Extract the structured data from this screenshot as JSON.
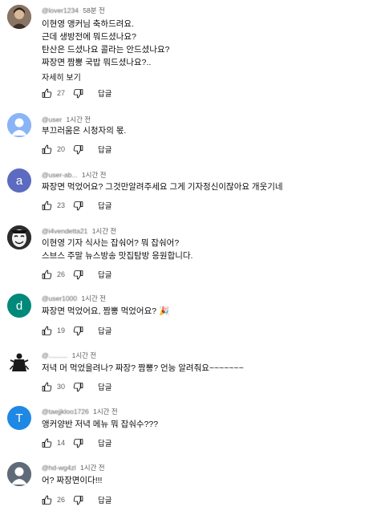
{
  "comments": [
    {
      "handle": "@lover1234",
      "time": "58분 전",
      "avatar_color": "#6d5a4a",
      "avatar_icon": "photo-avatar",
      "lines": [
        "이현영 앵커님 축하드려요.",
        "근데 생방전에 뭐드셨나요?",
        "탄산은 드셨나요 콜라는 안드셨나요?",
        "짜장면 짬뽕 국밥 뭐드셨나요?.."
      ],
      "more": "자세히 보기",
      "likes": "27",
      "reply": "답글"
    },
    {
      "handle": "@user",
      "time": "1시간 전",
      "avatar_color": "#8ab4f8",
      "avatar_icon": "default-person-avatar",
      "lines": [
        "부끄러움은 시청자의  몫."
      ],
      "likes": "20",
      "reply": "답글"
    },
    {
      "handle": "@user-ab...",
      "time": "1시간 전",
      "avatar_color": "#5c6bc0",
      "avatar_letter": "a",
      "lines": [
        "짜장면 먹었어요?  그것만알려주세요 그게 기자정신이잖아요 개웃기네"
      ],
      "likes": "23",
      "reply": "답글"
    },
    {
      "handle": "@i4vendetta21",
      "time": "1시간 전",
      "avatar_color": "#3a3a3a",
      "avatar_icon": "mask-avatar",
      "lines": [
        "이현영 기자 식사는 잡숴어? 뭐 잡숴어?",
        "스브스 주말 뉴스방송 맛집탐방 응원합니다."
      ],
      "likes": "26",
      "reply": "답글"
    },
    {
      "handle": "@user1000",
      "time": "1시간 전",
      "avatar_color": "#00897b",
      "avatar_letter": "d",
      "lines": [
        "짜장면 먹었어요, 짬뽕 먹었어요?"
      ],
      "emoji": "🎉",
      "likes": "19",
      "reply": "답글"
    },
    {
      "handle": "@..........",
      "time": "1시간 전",
      "avatar_color": "#ffffff",
      "avatar_icon": "warrior-avatar",
      "lines": [
        "저녁 머 먹었을려나?  짜장?  짬뽕?  언능 알려줘요~~~~~~~"
      ],
      "likes": "30",
      "reply": "답글"
    },
    {
      "handle": "@taejjkloo1726",
      "time": "1시간 전",
      "avatar_color": "#1e88e5",
      "avatar_letter": "T",
      "lines": [
        "앵커양반 저녁 메뉴 뭐 잡숴수???"
      ],
      "likes": "14",
      "reply": "답글"
    },
    {
      "handle": "@hd-wg4zl",
      "time": "1시간 전",
      "avatar_color": "#5f6b78",
      "avatar_icon": "default-person-avatar",
      "lines": [
        "어? 짜장면이다!!!"
      ],
      "likes": "26",
      "reply": "답글"
    }
  ]
}
